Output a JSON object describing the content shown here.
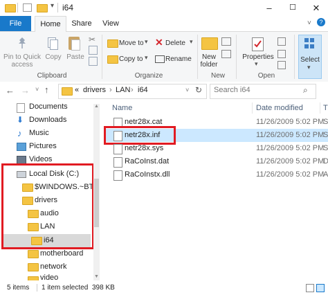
{
  "window": {
    "title": "i64",
    "controls": {
      "minimize": "–",
      "maximize": "☐",
      "close": "✕"
    }
  },
  "tabs": [
    {
      "label": "File"
    },
    {
      "label": "Home"
    },
    {
      "label": "Share"
    },
    {
      "label": "View"
    }
  ],
  "ribbon": {
    "pin_label_1": "Pin to Quick",
    "pin_label_2": "access",
    "copy": "Copy",
    "paste": "Paste",
    "clipboard": "Clipboard",
    "move_to": "Move to",
    "copy_to": "Copy to",
    "delete": "Delete",
    "rename": "Rename",
    "organize": "Organize",
    "new_folder_1": "New",
    "new_folder_2": "folder",
    "new": "New",
    "properties": "Properties",
    "open": "Open",
    "select": "Select"
  },
  "address": {
    "prefix": "«",
    "segments": [
      "drivers",
      "LAN",
      "i64"
    ],
    "separator": "›",
    "search_placeholder": "Search i64"
  },
  "nav": {
    "items": [
      {
        "label": "Documents"
      },
      {
        "label": "Downloads"
      },
      {
        "label": "Music"
      },
      {
        "label": "Pictures"
      },
      {
        "label": "Videos"
      },
      {
        "label": "Local Disk (C:)"
      },
      {
        "label": "$WINDOWS.~BT"
      },
      {
        "label": "drivers"
      },
      {
        "label": "audio"
      },
      {
        "label": "LAN"
      },
      {
        "label": "i64"
      },
      {
        "label": "motherboard"
      },
      {
        "label": "network"
      },
      {
        "label": "video"
      }
    ]
  },
  "columns": {
    "name": "Name",
    "date": "Date modified",
    "type": "T"
  },
  "files": [
    {
      "name": "netr28x.cat",
      "date": "11/26/2009 5:02 PM",
      "type": "S"
    },
    {
      "name": "netr28x.inf",
      "date": "11/26/2009 5:02 PM",
      "type": "S"
    },
    {
      "name": "netr28x.sys",
      "date": "11/26/2009 5:02 PM",
      "type": "S"
    },
    {
      "name": "RaCoInst.dat",
      "date": "11/26/2009 5:02 PM",
      "type": "D"
    },
    {
      "name": "RaCoInstx.dll",
      "date": "11/26/2009 5:02 PM",
      "type": "A"
    }
  ],
  "status": {
    "count": "5 items",
    "selected": "1 item selected",
    "size": "398 KB"
  }
}
